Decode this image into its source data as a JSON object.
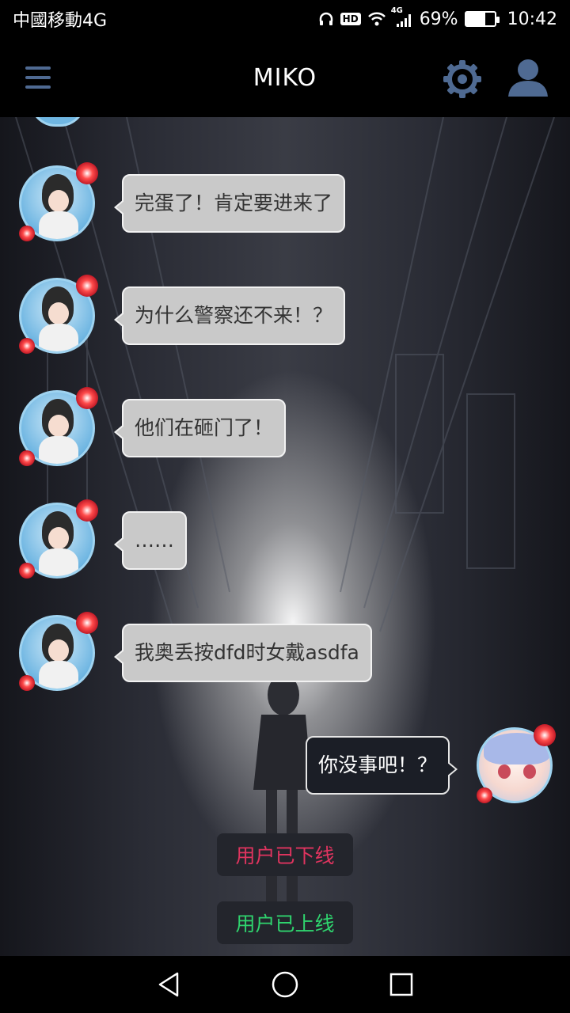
{
  "status_bar": {
    "carrier": "中國移動4G",
    "hd_label": "HD",
    "network_label": "4G",
    "battery_percent": "69%",
    "battery_level": 0.69,
    "time": "10:42"
  },
  "app_bar": {
    "title": "MIKO"
  },
  "messages": [
    {
      "side": "left",
      "text": "完蛋了！肯定要进来了"
    },
    {
      "side": "left",
      "text": "为什么警察还不来！？"
    },
    {
      "side": "left",
      "text": "他们在砸门了！"
    },
    {
      "side": "left",
      "text": "……"
    },
    {
      "side": "left",
      "text": "我奥丢按dfd时女戴asdfa"
    },
    {
      "side": "right",
      "text": "你没事吧！？"
    }
  ],
  "system_messages": [
    {
      "text": "用户已下线",
      "color": "#e0345f"
    },
    {
      "text": "用户已上线",
      "color": "#2fd46e"
    }
  ],
  "colors": {
    "icon_accent": "#4f6a92",
    "bubble_incoming": "#c9c9c9",
    "bubble_outgoing": "#1b1e26"
  }
}
